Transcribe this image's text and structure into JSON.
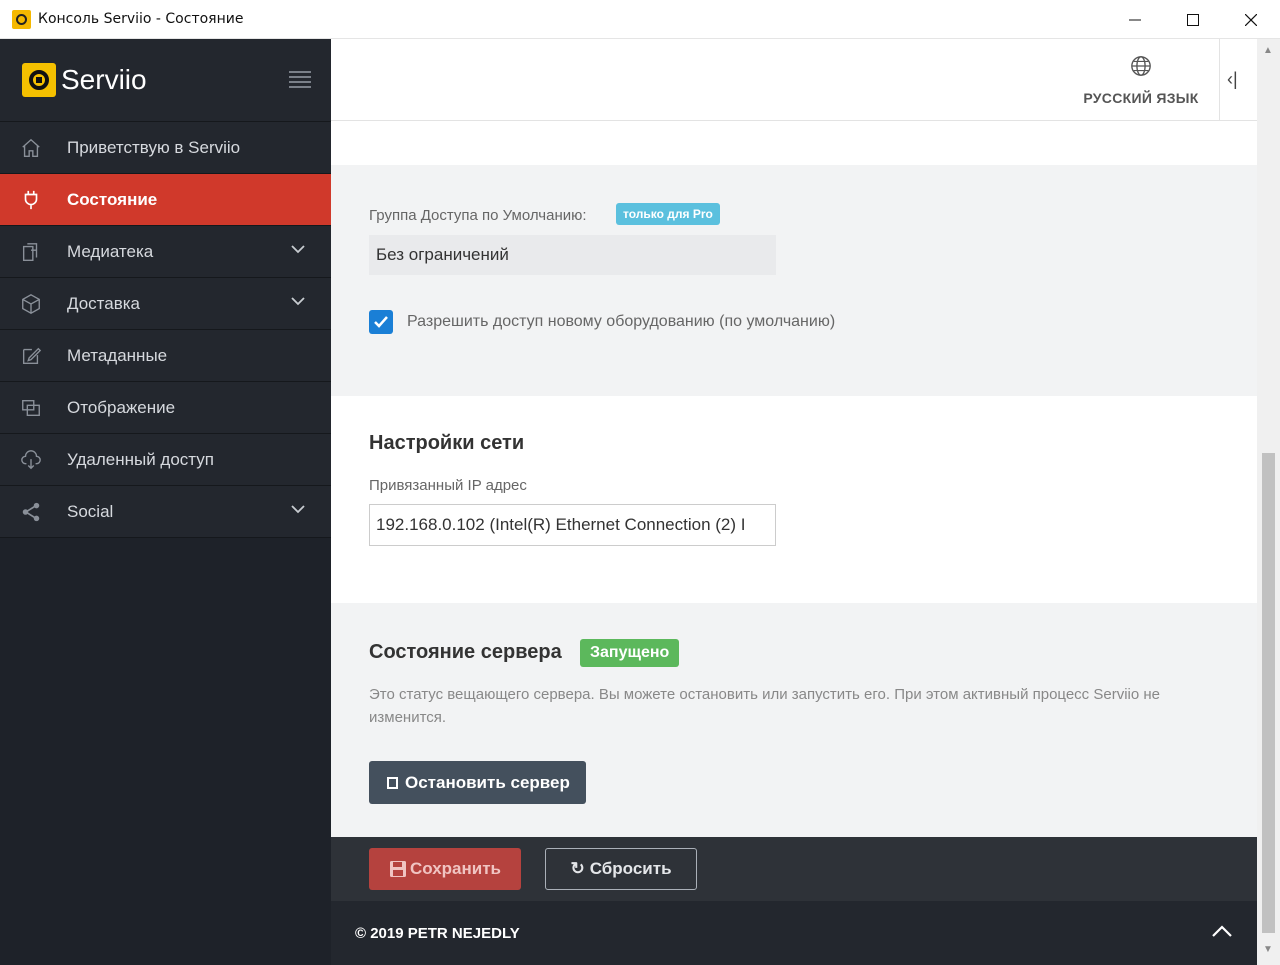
{
  "window": {
    "title": "Консоль Serviio - Состояние",
    "icon": "serviio-logo-icon"
  },
  "sidebar": {
    "brand": "Serviio",
    "items": [
      {
        "label": "Приветствую в Serviio",
        "icon": "home-icon",
        "active": false,
        "expandable": false
      },
      {
        "label": "Состояние",
        "icon": "plug-icon",
        "active": true,
        "expandable": false
      },
      {
        "label": "Медиатека",
        "icon": "library-icon",
        "active": false,
        "expandable": true
      },
      {
        "label": "Доставка",
        "icon": "box-icon",
        "active": false,
        "expandable": true
      },
      {
        "label": "Метаданные",
        "icon": "edit-icon",
        "active": false,
        "expandable": false
      },
      {
        "label": "Отображение",
        "icon": "screens-icon",
        "active": false,
        "expandable": false
      },
      {
        "label": "Удаленный доступ",
        "icon": "cloud-download-icon",
        "active": false,
        "expandable": false
      },
      {
        "label": "Social",
        "icon": "share-icon",
        "active": false,
        "expandable": true
      }
    ]
  },
  "topbar": {
    "language_label": "РУССКИЙ ЯЗЫК"
  },
  "access": {
    "group_label": "Группа Доступа по Умолчанию:",
    "pro_badge": "только для Pro",
    "group_value": "Без ограничений",
    "allow_new_devices_label": "Разрешить доступ новому оборудованию (по умолчанию)",
    "allow_new_devices_checked": true
  },
  "network": {
    "heading": "Настройки сети",
    "bound_ip_label": "Привязанный IP адрес",
    "bound_ip_value": "192.168.0.102 (Intel(R) Ethernet Connection (2) I"
  },
  "server": {
    "heading": "Состояние сервера",
    "status_badge": "Запущено",
    "description": "Это статус вещающего сервера. Вы можете остановить или запустить его. При этом активный процесс Serviio не изменится.",
    "stop_button": "Остановить сервер"
  },
  "actions": {
    "save_label": "Сохранить",
    "reset_label": "Сбросить"
  },
  "footer": {
    "copyright": "© 2019 PETR NEJEDLY"
  },
  "colors": {
    "accent_red": "#d0392b",
    "sidebar_bg": "#23272e",
    "status_green": "#5cb85c",
    "pro_blue": "#5bc0de",
    "checkbox_blue": "#1a7fd6"
  }
}
